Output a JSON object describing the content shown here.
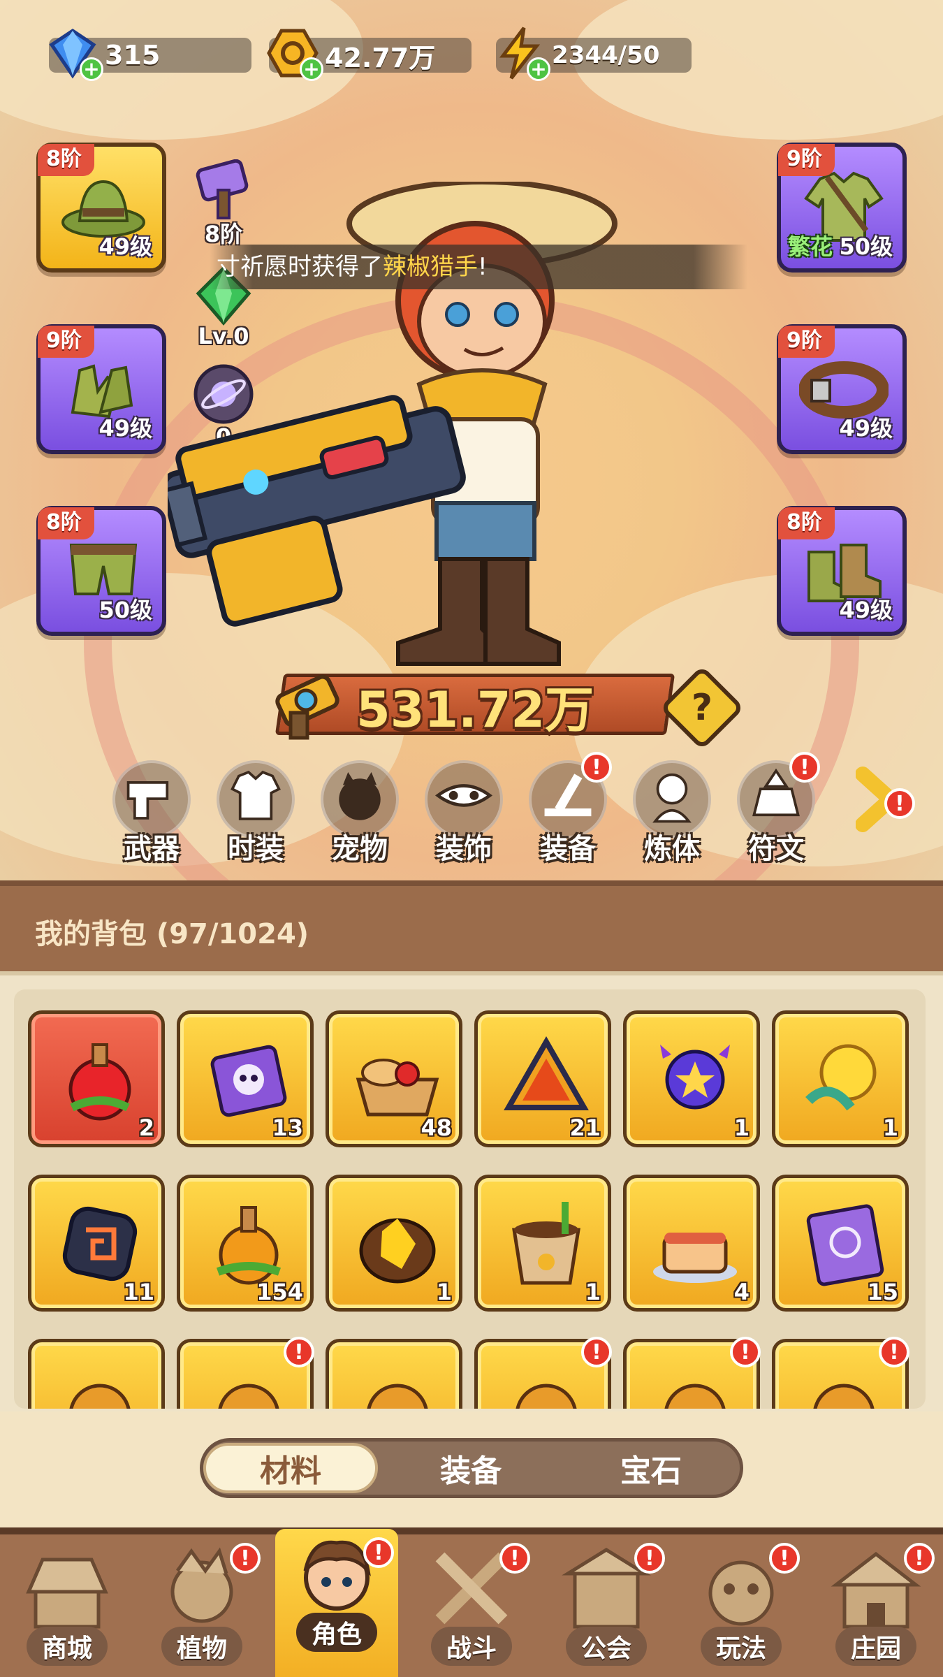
{
  "currency": {
    "gems": "315",
    "gold": "42.77万",
    "energy": "2344/50"
  },
  "equipment": {
    "hat": {
      "tier": "8阶",
      "level": "49级"
    },
    "gloves": {
      "tier": "9阶",
      "level": "49级"
    },
    "pants": {
      "tier": "8阶",
      "level": "50级"
    },
    "shirt": {
      "tier": "9阶",
      "level": "50级",
      "set_label": "繁花"
    },
    "belt": {
      "tier": "9阶",
      "level": "49级"
    },
    "boots": {
      "tier": "8阶",
      "level": "49级"
    }
  },
  "stats": {
    "hammer_label": "8阶",
    "gem_label": "Lv.0",
    "orb_label": "0"
  },
  "banner": {
    "prefix": "寸祈愿时获得了",
    "highlight": "辣椒猎手",
    "suffix": "!"
  },
  "power": {
    "value": "531.72万",
    "help_label": "?"
  },
  "functions": [
    {
      "label": "武器",
      "alert": false
    },
    {
      "label": "时装",
      "alert": false
    },
    {
      "label": "宠物",
      "alert": false
    },
    {
      "label": "装饰",
      "alert": false
    },
    {
      "label": "装备",
      "alert": true
    },
    {
      "label": "炼体",
      "alert": false
    },
    {
      "label": "符文",
      "alert": true
    }
  ],
  "alert_mark": "!",
  "backpack": {
    "title": "我的背包 (97/1024)",
    "items": [
      {
        "icon": "apple-potion-icon",
        "count": "2"
      },
      {
        "icon": "skull-scroll-icon",
        "count": "13"
      },
      {
        "icon": "food-basket-icon",
        "count": "48"
      },
      {
        "icon": "fire-prism-icon",
        "count": "21"
      },
      {
        "icon": "star-orb-icon",
        "count": "1"
      },
      {
        "icon": "golden-flower-icon",
        "count": "1"
      },
      {
        "icon": "rune-stone-icon",
        "count": "11"
      },
      {
        "icon": "orange-potion-icon",
        "count": "154"
      },
      {
        "icon": "gold-ore-icon",
        "count": "1"
      },
      {
        "icon": "flower-pot-icon",
        "count": "1"
      },
      {
        "icon": "cake-icon",
        "count": "4"
      },
      {
        "icon": "spell-book-icon",
        "count": "15"
      }
    ],
    "partial_row_alerts": [
      false,
      true,
      false,
      true,
      true,
      true
    ]
  },
  "tabs": [
    {
      "label": "材料",
      "active": true
    },
    {
      "label": "装备",
      "active": false
    },
    {
      "label": "宝石",
      "active": false
    }
  ],
  "bottom_nav": [
    {
      "label": "商城",
      "active": false,
      "alert": false
    },
    {
      "label": "植物",
      "active": false,
      "alert": true
    },
    {
      "label": "角色",
      "active": true,
      "alert": true
    },
    {
      "label": "战斗",
      "active": false,
      "alert": true
    },
    {
      "label": "公会",
      "active": false,
      "alert": true
    },
    {
      "label": "玩法",
      "active": false,
      "alert": true
    },
    {
      "label": "庄园",
      "active": false,
      "alert": true
    }
  ],
  "colors": {
    "gold_slot": "#f3b419",
    "purple_slot": "#7a4fe0",
    "tier_badge": "#e2513d",
    "alert_red": "#e8372a",
    "highlight_text": "#ffd54a"
  }
}
